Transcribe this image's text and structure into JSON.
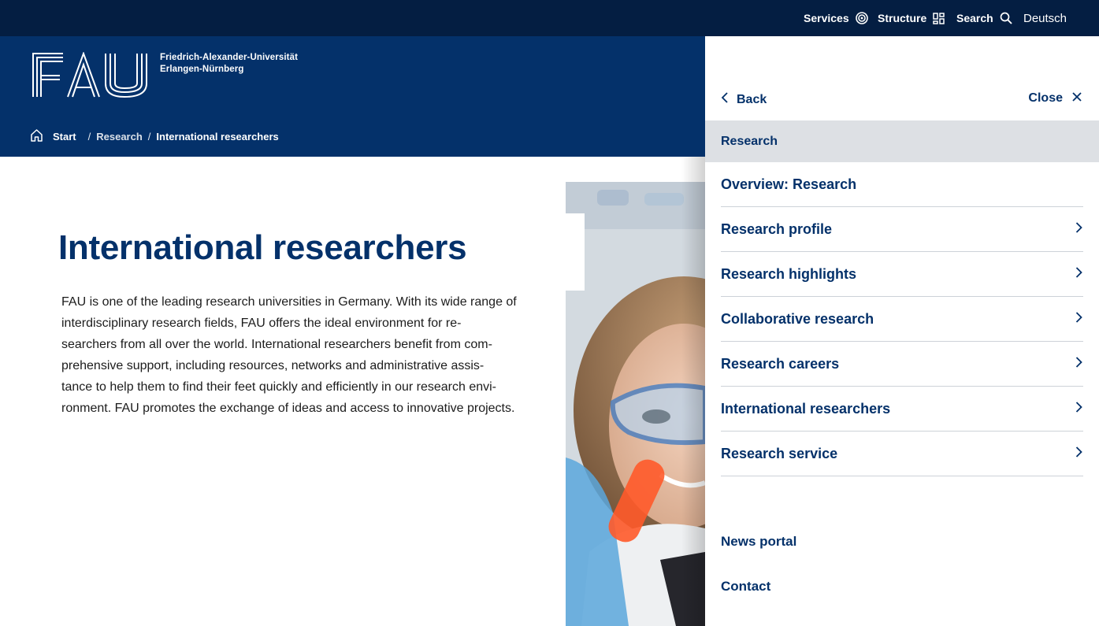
{
  "colors": {
    "topbar": "#041e42",
    "brand_blue": "#04316a",
    "panel_section_bg": "#dde0e4"
  },
  "topbar": {
    "services_label": "Services",
    "services_icon": "target-icon",
    "structure_label": "Structure",
    "structure_icon": "grid-icon",
    "search_label": "Search",
    "search_icon": "search-icon",
    "language_label": "Deutsch"
  },
  "header": {
    "logo_letters": "FAU",
    "university_line1": "Friedrich-Alexander-Universität",
    "university_line2": "Erlangen-Nürnberg",
    "breadcrumb": {
      "home_label": "Start",
      "parent_label": "Research",
      "current_label": "International researchers",
      "separator": "/"
    }
  },
  "main": {
    "title": "International researchers",
    "intro_lines": [
      "FAU is one of the leading research universities in Germany. With its wide range of",
      "interdisciplinary research fields, FAU offers the ideal environment for re-",
      "searchers from all over the world. International researchers benefit from com-",
      "prehensive support, including resources, networks and administrative assis-",
      "tance to help them to find their feet quickly and efficiently in our research envi-",
      "ronment. FAU promotes the exchange of ideas and access to innovative projects."
    ]
  },
  "nav_panel": {
    "back_label": "Back",
    "close_label": "Close",
    "section_label": "Research",
    "items": [
      {
        "label": "Overview: Research",
        "has_children": false
      },
      {
        "label": "Research profile",
        "has_children": true
      },
      {
        "label": "Research highlights",
        "has_children": true
      },
      {
        "label": "Collaborative research",
        "has_children": true
      },
      {
        "label": "Research careers",
        "has_children": true
      },
      {
        "label": "International researchers",
        "has_children": true
      },
      {
        "label": "Research service",
        "has_children": true
      }
    ],
    "news_label": "News portal",
    "contact_label": "Contact"
  }
}
